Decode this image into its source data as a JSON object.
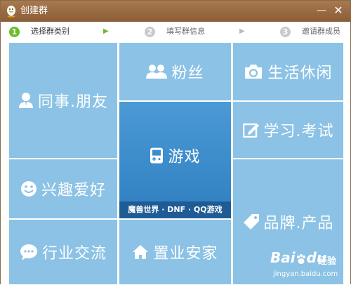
{
  "window": {
    "title": "创建群",
    "minimize_glyph": "—",
    "close_glyph": "✕"
  },
  "steps": [
    {
      "num": "1",
      "label": "选择群类别",
      "state": "active"
    },
    {
      "num": "2",
      "label": "填写群信息",
      "state": "inactive"
    },
    {
      "num": "3",
      "label": "邀请群成员",
      "state": "inactive"
    }
  ],
  "categories": {
    "colleagues_friends": {
      "label": "同事.朋友",
      "icon": "person-icon"
    },
    "fans": {
      "label": "粉丝",
      "icon": "people-icon"
    },
    "life_leisure": {
      "label": "生活休闲",
      "icon": "camera-icon"
    },
    "games": {
      "label": "游戏",
      "icon": "gamepad-icon",
      "caption": "魔兽世界 · DNF · QQ游戏"
    },
    "study_exam": {
      "label": "学习.考试",
      "icon": "edit-icon"
    },
    "hobbies": {
      "label": "兴趣爱好",
      "icon": "smiley-icon"
    },
    "industry": {
      "label": "行业交流",
      "icon": "chat-bubble-icon"
    },
    "real_estate": {
      "label": "置业安家",
      "icon": "house-icon"
    },
    "brand_product": {
      "label": "品牌.产品",
      "icon": "tag-icon"
    }
  },
  "watermark": {
    "brand": "Bai",
    "brand2": "du",
    "jingyan": "经验",
    "url": "jingyan.baidu.com"
  },
  "colors": {
    "titlebar": "#9a6a42",
    "tile": "#8bc2e5",
    "featured_tile": "#3d8ccc",
    "active_step": "#6bbd2a",
    "inactive_step": "#c9c9c9"
  }
}
